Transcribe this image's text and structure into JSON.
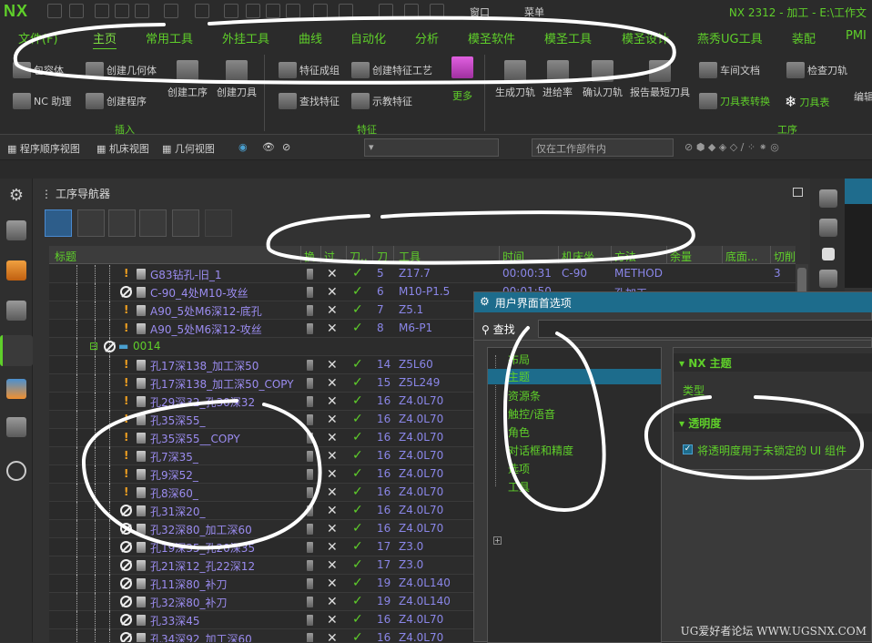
{
  "app": {
    "logo": "NX",
    "window_title": "NX 2312 - 加工 - E:\\工作文",
    "window_menu": "窗口",
    "menu_label": "菜单"
  },
  "tabs": [
    "文件(F)",
    "主页",
    "常用工具",
    "外挂工具",
    "曲线",
    "自动化",
    "分析",
    "模圣软件",
    "模圣工具",
    "模圣设计",
    "燕秀UG工具",
    "装配",
    "PMI"
  ],
  "active_tab": "主页",
  "ribbon": {
    "insert": {
      "items": [
        "包容体",
        "创建几何体",
        "NC 助理",
        "创建程序",
        "创建工序",
        "创建刀具"
      ],
      "group": "插入"
    },
    "feature": {
      "items": [
        "特征成组",
        "创建特征工艺",
        "查找特征",
        "示教特征"
      ],
      "more": "更多",
      "group": "特征"
    },
    "operation": {
      "items": [
        "生成刀轨",
        "进给率",
        "确认刀轨",
        "报告最短刀具",
        "车间文档",
        "检查刀轨",
        "刀具表转换",
        "刀具表",
        "编辑数"
      ],
      "group": "工序"
    }
  },
  "toolbar2": {
    "views": [
      "程序顺序视图",
      "机床视图",
      "几何视图"
    ],
    "filter_placeholder": "仅在工作部件内"
  },
  "navigator": {
    "title": "工序导航器",
    "columns": [
      "标题",
      "换",
      "过",
      "刀..",
      "刀",
      "工具",
      "时间",
      "机床坐...",
      "方法",
      "余量",
      "底面...",
      "切削"
    ],
    "rows": [
      {
        "name": "G83钻孔-旧_1",
        "n": "5",
        "tool": "Z17.7",
        "time": "00:00:31",
        "mcs": "C-90",
        "method": "METHOD",
        "cut": "3",
        "status": "warn"
      },
      {
        "name": "C-90_4处M10-攻丝",
        "n": "6",
        "tool": "M10-P1.5",
        "time": "00:01:50",
        "mcs": "",
        "method": "孔加工",
        "status": "no"
      },
      {
        "name": "A90_5处M6深12-底孔",
        "n": "7",
        "tool": "Z5.1",
        "status": "warn"
      },
      {
        "name": "A90_5处M6深12-攻丝",
        "n": "8",
        "tool": "M6-P1",
        "status": "warn"
      },
      {
        "name": "0014",
        "folder": true
      },
      {
        "name": "孔17深138_加工深50",
        "n": "14",
        "tool": "Z5L60",
        "status": "warn"
      },
      {
        "name": "孔17深138_加工深50_COPY",
        "n": "15",
        "tool": "Z5L249",
        "status": "warn"
      },
      {
        "name": "孔29深32_孔30深32",
        "n": "16",
        "tool": "Z4.0L70",
        "status": "warn"
      },
      {
        "name": "孔35深55_",
        "n": "16",
        "tool": "Z4.0L70",
        "status": "warn"
      },
      {
        "name": "孔35深55__COPY",
        "n": "16",
        "tool": "Z4.0L70",
        "status": "warn"
      },
      {
        "name": "孔7深35_",
        "n": "16",
        "tool": "Z4.0L70",
        "status": "warn"
      },
      {
        "name": "孔9深52_",
        "n": "16",
        "tool": "Z4.0L70",
        "status": "warn"
      },
      {
        "name": "孔8深60_",
        "n": "16",
        "tool": "Z4.0L70",
        "status": "warn"
      },
      {
        "name": "孔31深20_",
        "n": "16",
        "tool": "Z4.0L70",
        "status": "no"
      },
      {
        "name": "孔32深80_加工深60",
        "n": "16",
        "tool": "Z4.0L70",
        "status": "no"
      },
      {
        "name": "孔19深35_孔20深35",
        "n": "17",
        "tool": "Z3.0",
        "status": "no"
      },
      {
        "name": "孔21深12_孔22深12",
        "n": "17",
        "tool": "Z3.0",
        "status": "no"
      },
      {
        "name": "孔11深80_补刀",
        "n": "19",
        "tool": "Z4.0L140",
        "status": "no"
      },
      {
        "name": "孔32深80_补刀",
        "n": "19",
        "tool": "Z4.0L140",
        "status": "no"
      },
      {
        "name": "孔33深45",
        "n": "16",
        "tool": "Z4.0L70",
        "status": "no"
      },
      {
        "name": "孔34深92_加工深60",
        "n": "16",
        "tool": "Z4.0L70",
        "status": "no"
      }
    ]
  },
  "dialog": {
    "title": "用户界面首选项",
    "search_label": "查找",
    "categories": [
      "布局",
      "主题",
      "资源条",
      "触控/语音",
      "角色",
      "对话框和精度",
      "选项",
      "工具"
    ],
    "selected_category": "主题",
    "section_theme": "NX 主题",
    "type_label": "类型",
    "section_transparency": "透明度",
    "checkbox_label": "将透明度用于未锁定的 UI 组件",
    "checkbox_checked": true
  },
  "watermark": "UG爱好者论坛 WWW.UGSNX.COM"
}
